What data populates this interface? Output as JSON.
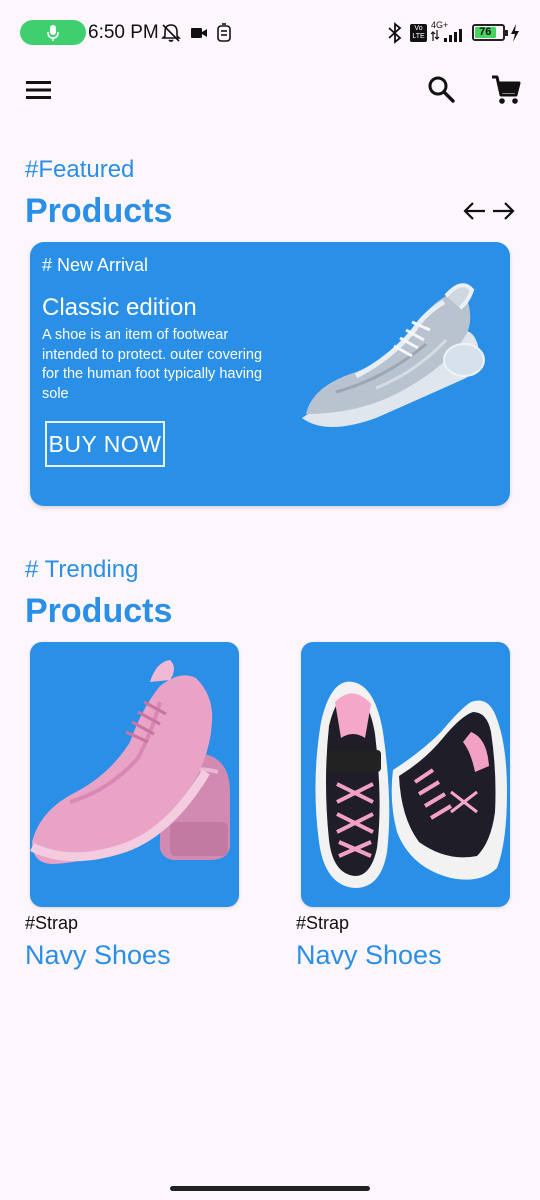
{
  "status_bar": {
    "time": "6:50 PM",
    "battery_level": "76",
    "network_label": "4G+",
    "volte_label": "Vo LTE",
    "icons": [
      "mic-icon",
      "alarm-off-icon",
      "video-icon",
      "data-saver-icon",
      "bluetooth-icon",
      "volte-icon",
      "signal-icon",
      "battery-icon",
      "charging-icon"
    ],
    "mic_pill_color": "#3fcf6f"
  },
  "app_bar": {
    "icons": [
      "menu-icon",
      "search-icon",
      "cart-icon"
    ]
  },
  "featured": {
    "tag": "#Featured",
    "title": "Products",
    "nav_icons": [
      "arrow-left-icon",
      "arrow-right-icon"
    ],
    "card": {
      "tag": "# New Arrival",
      "title": "Classic edition",
      "description": "A shoe is an item of footwear intended to protect. outer covering for the human foot typically having sole",
      "button_label": "BUY NOW"
    }
  },
  "trending": {
    "tag": "# Trending",
    "title": "Products",
    "products": [
      {
        "category": "#Strap",
        "name": "Navy Shoes"
      },
      {
        "category": "#Strap",
        "name": "Navy Shoes"
      }
    ]
  },
  "colors": {
    "accent": "#2a8fe6",
    "background": "#fdf7fd"
  }
}
